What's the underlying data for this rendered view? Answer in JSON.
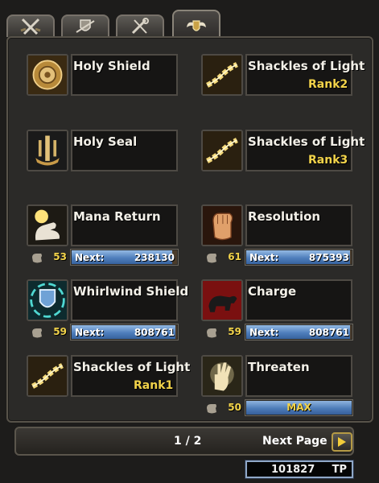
{
  "tabs": [
    {
      "icon": "crossed-swords-icon",
      "active": false
    },
    {
      "icon": "shield-emblem-icon",
      "active": false
    },
    {
      "icon": "tools-icon",
      "active": false
    },
    {
      "icon": "winged-shield-icon",
      "active": true
    }
  ],
  "skills": [
    {
      "name": "Holy Shield",
      "rank": "",
      "icon": "holy-shield-icon"
    },
    {
      "name": "Shackles of Light",
      "rank": "Rank2",
      "icon": "chain-icon"
    },
    {
      "name": "Holy Seal",
      "rank": "",
      "icon": "holy-seal-icon"
    },
    {
      "name": "Shackles of Light",
      "rank": "Rank3",
      "icon": "chain-icon"
    },
    {
      "name": "Mana Return",
      "rank": "",
      "icon": "mana-return-icon",
      "level": "53",
      "bar_label": "Next:",
      "bar_value": "238130"
    },
    {
      "name": "Resolution",
      "rank": "",
      "icon": "fist-icon",
      "level": "61",
      "bar_label": "Next:",
      "bar_value": "875393"
    },
    {
      "name": "Whirlwind Shield",
      "rank": "",
      "icon": "whirlwind-shield-icon",
      "level": "59",
      "bar_label": "Next:",
      "bar_value": "808761"
    },
    {
      "name": "Charge",
      "rank": "",
      "icon": "charging-bull-icon",
      "level": "59",
      "bar_label": "Next:",
      "bar_value": "808761"
    },
    {
      "name": "Shackles of Light",
      "rank": "Rank1",
      "icon": "chain-icon"
    },
    {
      "name": "Threaten",
      "rank": "",
      "icon": "open-hand-icon",
      "level": "50",
      "bar_max": "MAX"
    }
  ],
  "footer": {
    "page_indicator": "1 / 2",
    "next_label": "Next Page"
  },
  "tp": {
    "value": "101827",
    "unit": "TP"
  },
  "colors": {
    "rank": "#f2d34a",
    "bar": "#4f7fbd",
    "level": "#f2d34a"
  }
}
